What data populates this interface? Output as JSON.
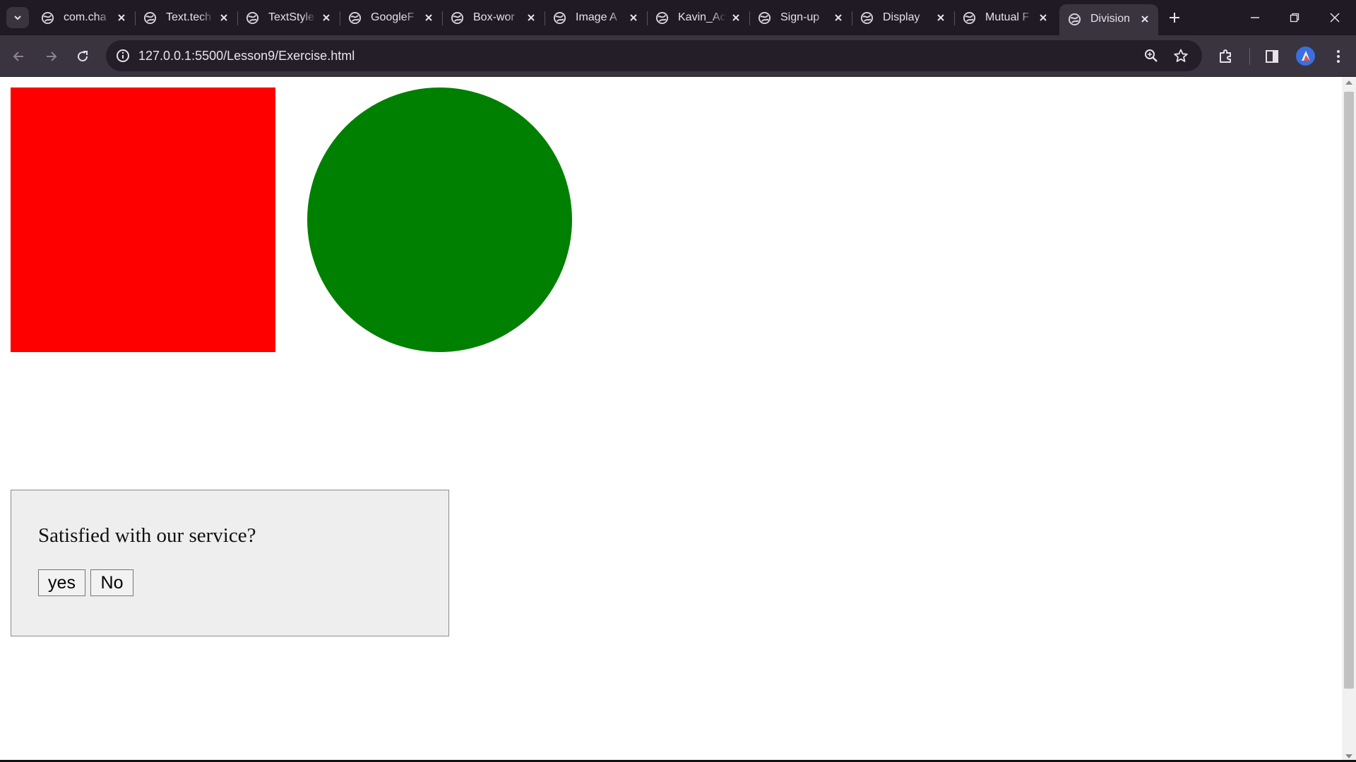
{
  "browser": {
    "tabs": [
      {
        "label": "com.cha"
      },
      {
        "label": "Text.tech"
      },
      {
        "label": "TextStyle"
      },
      {
        "label": "GoogleF"
      },
      {
        "label": "Box-wor"
      },
      {
        "label": "Image A"
      },
      {
        "label": "Kavin_Ac"
      },
      {
        "label": "Sign-up"
      },
      {
        "label": "Display"
      },
      {
        "label": "Mutual F"
      },
      {
        "label": "Division",
        "active": true
      }
    ],
    "address": "127.0.0.1:5500/Lesson9/Exercise.html",
    "icons": {
      "tab_search": "chevron-down-icon",
      "favicon": "globe-icon",
      "tab_close": "close-icon",
      "new_tab": "plus-icon",
      "minimize": "minimize-icon",
      "restore": "restore-icon",
      "close_window": "close-icon",
      "back": "back-arrow-icon",
      "forward": "forward-arrow-icon",
      "reload": "reload-icon",
      "site_info": "info-icon",
      "zoom": "zoom-icon",
      "bookmark": "star-icon",
      "extensions": "puzzle-icon",
      "side_panel": "side-panel-icon",
      "menu": "kebab-menu-icon"
    }
  },
  "page": {
    "square_color": "#ff0000",
    "circle_color": "#008000",
    "survey": {
      "question": "Satisfied with our service?",
      "yes_label": "yes",
      "no_label": "No"
    }
  },
  "colors": {
    "tabstrip_bg": "#1f1a24",
    "toolbar_bg": "#3a3340",
    "omnibox_bg": "#241e29",
    "survey_bg": "#eeeeee"
  }
}
